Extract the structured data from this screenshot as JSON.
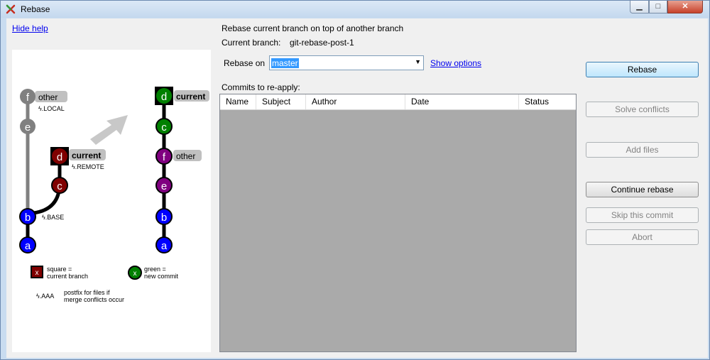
{
  "window": {
    "title": "Rebase"
  },
  "help": {
    "hide_link": "Hide help",
    "diagram": {
      "left": {
        "f": "f",
        "e": "e",
        "d": "d",
        "c": "c",
        "b": "b",
        "a": "a",
        "other_label": "other",
        "local_label": ".LOCAL",
        "current_label": "current",
        "remote_label": ".REMOTE",
        "base_label": ".BASE"
      },
      "right": {
        "d": "d",
        "c": "c",
        "f": "f",
        "e": "e",
        "b": "b",
        "a": "a",
        "current_label": "current",
        "other_label": "other"
      },
      "legend": {
        "square_marker": "x",
        "square_text_1": "square =",
        "square_text_2": "current branch",
        "green_marker": "x",
        "green_text_1": "green =",
        "green_text_2": "new commit",
        "postfix_label": ".AAA",
        "postfix_text_1": "postfix for files if",
        "postfix_text_2": "merge conflicts occur"
      },
      "colors": {
        "gray": "#808080",
        "red": "#800000",
        "blue": "#0000ff",
        "green": "#008000",
        "purple": "#800080"
      }
    }
  },
  "main": {
    "heading": "Rebase current branch on top of another branch",
    "current_branch_label": "Current branch:",
    "current_branch_value": "git-rebase-post-1",
    "rebase_on_label": "Rebase on",
    "rebase_on_value": "master",
    "show_options": "Show options",
    "commits_label": "Commits to re-apply:",
    "columns": [
      "Name",
      "Subject",
      "Author",
      "Date",
      "Status"
    ]
  },
  "buttons": {
    "rebase": "Rebase",
    "solve_conflicts": "Solve conflicts",
    "add_files": "Add files",
    "continue_rebase": "Continue rebase",
    "skip_commit": "Skip this commit",
    "abort": "Abort"
  }
}
